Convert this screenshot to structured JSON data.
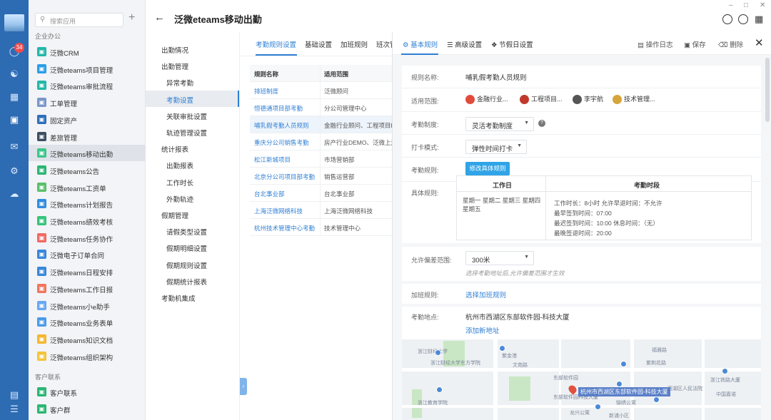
{
  "app": {
    "title": "泛微eteams移动出勤",
    "badge_count": "34"
  },
  "app_list": {
    "search_placeholder": "搜索应用",
    "group_enterprise": "企业办公",
    "group_customer": "客户联系",
    "items": [
      {
        "label": "泛微CRM",
        "color": "#23b7a8"
      },
      {
        "label": "泛微eteams项目管理",
        "color": "#2a9ee8"
      },
      {
        "label": "泛微eteams审批流程",
        "color": "#23b7a8"
      },
      {
        "label": "工单管理",
        "color": "#7a97c9"
      },
      {
        "label": "固定资产",
        "color": "#2f6fb8"
      },
      {
        "label": "差旅管理",
        "color": "#3d4e62"
      },
      {
        "label": "泛微eteams移动出勤",
        "color": "#3cc68a"
      },
      {
        "label": "泛微eteams公告",
        "color": "#2bb673"
      },
      {
        "label": "泛微eteams工资单",
        "color": "#5ac06b"
      },
      {
        "label": "泛微eteams计划报告",
        "color": "#2f8de0"
      },
      {
        "label": "泛微eteams绩效考核",
        "color": "#38c37b"
      },
      {
        "label": "泛微eteams任务协作",
        "color": "#ef6b63"
      },
      {
        "label": "泛微电子订单合同",
        "color": "#3a87d8"
      },
      {
        "label": "泛微eteams日程安排",
        "color": "#3a87d8"
      },
      {
        "label": "泛微eteams工作日报",
        "color": "#f0765e"
      },
      {
        "label": "泛微eteams小e助手",
        "color": "#6aa7f0"
      },
      {
        "label": "泛微eteams业务表单",
        "color": "#4a9be8"
      },
      {
        "label": "泛微eteams知识文档",
        "color": "#f5b52e"
      },
      {
        "label": "泛微eteams组织架构",
        "color": "#f5c33b"
      }
    ],
    "customer_items": [
      {
        "label": "客户联系",
        "color": "#2bb673"
      },
      {
        "label": "客户群",
        "color": "#2bb673"
      }
    ]
  },
  "subnav": [
    {
      "label": "出勤情况",
      "level": "top"
    },
    {
      "label": "出勤管理",
      "level": "top"
    },
    {
      "label": "异常考勤",
      "level": "sub"
    },
    {
      "label": "考勤设置",
      "level": "sub",
      "selected": true
    },
    {
      "label": "关联审批设置",
      "level": "sub"
    },
    {
      "label": "轨迹管理设置",
      "level": "sub"
    },
    {
      "label": "统计报表",
      "level": "top"
    },
    {
      "label": "出勤报表",
      "level": "sub"
    },
    {
      "label": "工作时长",
      "level": "sub"
    },
    {
      "label": "外勤轨迹",
      "level": "sub"
    },
    {
      "label": "假期管理",
      "level": "top"
    },
    {
      "label": "请假类型设置",
      "level": "sub"
    },
    {
      "label": "假期明细设置",
      "level": "sub"
    },
    {
      "label": "假期规则设置",
      "level": "sub"
    },
    {
      "label": "假期统计报表",
      "level": "sub"
    },
    {
      "label": "考勤机集成",
      "level": "top"
    }
  ],
  "rules_tabs": [
    "考勤规则设置",
    "基础设置",
    "加班规则",
    "班次管"
  ],
  "rules_table": {
    "headers": [
      "规则名称",
      "适用范围"
    ],
    "rows": [
      [
        "排班制度",
        "泛微顾问"
      ],
      [
        "恒德通项目部考勤",
        "分公司管理中心"
      ],
      [
        "哺乳假考勤人员规则",
        "金融行业顾问、工程项目DE"
      ],
      [
        "重庆分公司销售考勤",
        "房产行业DEMO、泛微上海"
      ],
      [
        "松江新城项目",
        "市场营销部"
      ],
      [
        "北京分公司项目部考勤",
        "销售运营部"
      ],
      [
        "台北事业部",
        "台北事业部"
      ],
      [
        "上海泛微网络科技",
        "上海泛微网络科技"
      ],
      [
        "杭州技术管理中心考勤",
        "技术管理中心"
      ]
    ]
  },
  "detail": {
    "tabs": [
      "基本规则",
      "高级设置",
      "节假日设置"
    ],
    "actions": [
      "操作日志",
      "保存",
      "删除"
    ],
    "rule_name_label": "规则名称:",
    "rule_name": "哺乳假考勤人员规则",
    "scope_label": "适用范围:",
    "scopes": [
      "金融行业...",
      "工程项目...",
      "李宇航",
      "技术管理..."
    ],
    "system_label": "考勤制度:",
    "system_value": "灵活考勤制度",
    "punch_label": "打卡模式:",
    "punch_value": "弹性时间打卡",
    "rules_label": "考勤规则:",
    "edit_rule_button": "修改具体规则",
    "specific_label": "具体规则:",
    "schedule_headers": [
      "工作日",
      "考勤时段"
    ],
    "schedule_days": "星期一 星期二 星期三 星期四 星期五",
    "schedule_lines": [
      "工作时长：8小时 允许早退时间：不允许",
      "最早签到时间：07:00",
      "最迟签到时间：10:00  休息时间：（无）",
      "最晚签退时间：20:00"
    ],
    "deviation_label": "允许偏差范围:",
    "deviation_value": "300米",
    "deviation_hint": "选择考勤地址后,允许偏差范围才生效",
    "overtime_label": "加班规则:",
    "overtime_link": "选择加班规则",
    "location_label": "考勤地点:",
    "location_value": "杭州市西湖区东部软件园-科技大厦",
    "add_location_link": "添加新地址",
    "map_callout": "杭州市西湖区东部软件园-科技大厦",
    "map_labels": [
      "浙江财经大学",
      "浙江财经大学东方学院",
      "紫金港",
      "文苑路",
      "东部软件园",
      "东部软件园科技大厦",
      "锦绣公寓",
      "龙兴公寓",
      "紫荆花路",
      "浙江教育学院",
      "新浦小区",
      "福雅路",
      "西湖区人民法院",
      "浙江铁路大厦",
      "中国嘉诺"
    ]
  }
}
